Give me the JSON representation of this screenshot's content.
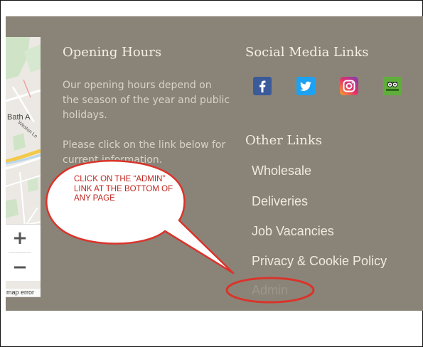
{
  "footer": {
    "opening_hours": {
      "heading": "Opening Hours",
      "para1": "Our opening hours depend on the season of the year and public holidays.",
      "para2": "Please click on the link below for current information."
    },
    "social": {
      "heading": "Social Media Links",
      "icons": [
        "facebook-icon",
        "twitter-icon",
        "instagram-icon",
        "tripadvisor-icon"
      ]
    },
    "other_links": {
      "heading": "Other Links",
      "items": [
        "Wholesale",
        "Deliveries",
        "Job Vacancies",
        "Privacy & Cookie Policy",
        "Admin"
      ]
    }
  },
  "map": {
    "street_label": "Weston Ln",
    "area_label": "Bath A",
    "zoom_in": "+",
    "zoom_out": "−",
    "error_text": "map error"
  },
  "annotation": {
    "callout_text": "CLICK ON THE “ADMIN” LINK AT THE BOTTOM OF ANY PAGE",
    "color": "#d9342b"
  },
  "colors": {
    "footer_bg": "#8a8478",
    "heading": "#f3efe2",
    "link": "#efeadf"
  }
}
